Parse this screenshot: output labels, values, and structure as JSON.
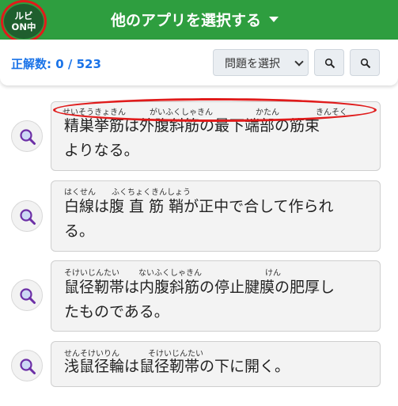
{
  "header": {
    "title": "他のアプリを選択する",
    "ruby_toggle": {
      "line1": "ルビ",
      "line2": "ON中"
    }
  },
  "toolbar": {
    "score_label": "正解数: 0 / 523",
    "select_value": "問題を選択",
    "zoom_out_icon": "zoom-out-icon",
    "zoom_in_icon": "zoom-in-icon"
  },
  "questions": [
    {
      "line1": "精巣挙筋は外腹斜筋の最下端部の筋束",
      "line2": "よりなる。",
      "furigana": [
        "せいそうきょきん",
        "がいふくしゃきん",
        "かたん",
        "きんそく"
      ]
    },
    {
      "line1": "白線は腹 直 筋 鞘が正中で合して作られ",
      "line2": "る。",
      "furigana": [
        "はくせん",
        "ふくちょくきんしょう"
      ]
    },
    {
      "line1": "鼠径靭帯は内腹斜筋の停止腱膜の肥厚し",
      "line2": "たものである。",
      "furigana": [
        "そけいじんたい",
        "ないふくしゃきん",
        "けん"
      ]
    },
    {
      "line1": "浅鼠径輪は鼠径靭帯の下に開く。",
      "line2": "",
      "furigana": [
        "せんそけいりん",
        "そけいじんたい"
      ]
    }
  ],
  "colors": {
    "header_bg": "#2e9e3f",
    "ruby_bg": "#1f5f2e",
    "score_text": "#1a73e8",
    "annotation_red": "#e01b1b"
  }
}
